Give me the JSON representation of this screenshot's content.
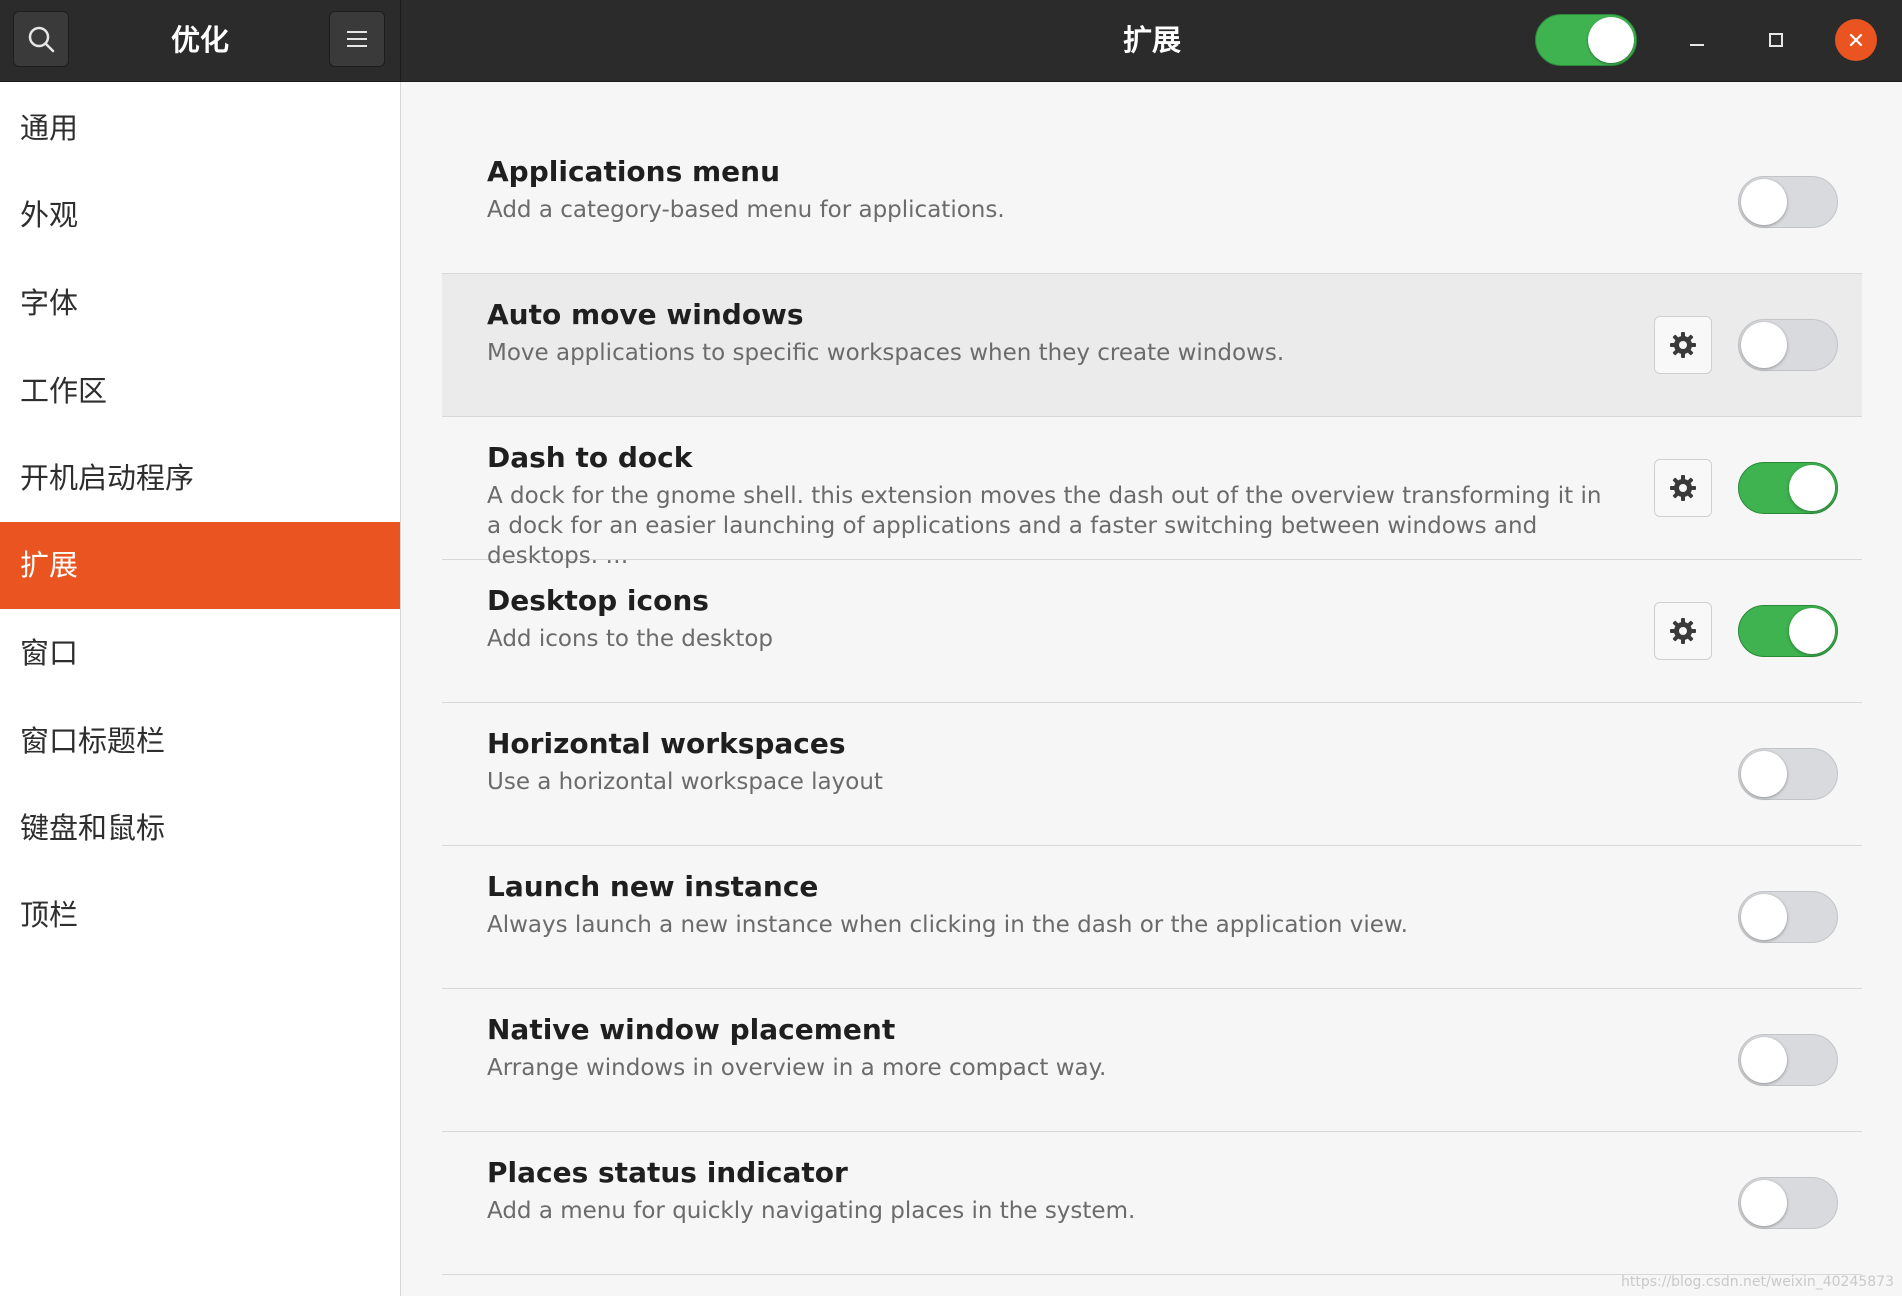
{
  "header": {
    "app_title": "优化",
    "page_title": "扩展",
    "master_switch_on": true,
    "accent_color": "#e95420",
    "switch_on_color": "#3eb34f"
  },
  "sidebar": {
    "items": [
      {
        "label": "通用"
      },
      {
        "label": "外观"
      },
      {
        "label": "字体"
      },
      {
        "label": "工作区"
      },
      {
        "label": "开机启动程序"
      },
      {
        "label": "扩展",
        "active": true
      },
      {
        "label": "窗口"
      },
      {
        "label": "窗口标题栏"
      },
      {
        "label": "键盘和鼠标"
      },
      {
        "label": "顶栏"
      }
    ]
  },
  "extensions": [
    {
      "title": "Applications menu",
      "description": "Add a category-based menu for applications.",
      "has_settings": false,
      "enabled": false
    },
    {
      "title": "Auto move windows",
      "description": "Move applications to specific workspaces when they create windows.",
      "has_settings": true,
      "enabled": false
    },
    {
      "title": "Dash to dock",
      "description": "A dock for the gnome shell. this extension moves the dash out of the overview transforming it in a dock for an easier launching of applications and a faster switching between windows and desktops. …",
      "has_settings": true,
      "enabled": true
    },
    {
      "title": "Desktop icons",
      "description": "Add icons to the desktop",
      "has_settings": true,
      "enabled": true
    },
    {
      "title": "Horizontal workspaces",
      "description": "Use a horizontal workspace layout",
      "has_settings": false,
      "enabled": false
    },
    {
      "title": "Launch new instance",
      "description": "Always launch a new instance when clicking in the dash or the application view.",
      "has_settings": false,
      "enabled": false
    },
    {
      "title": "Native window placement",
      "description": "Arrange windows in overview in a more compact way.",
      "has_settings": false,
      "enabled": false
    },
    {
      "title": "Places status indicator",
      "description": "Add a menu for quickly navigating places in the system.",
      "has_settings": false,
      "enabled": false
    }
  ],
  "watermark": "https://blog.csdn.net/weixin_40245873"
}
